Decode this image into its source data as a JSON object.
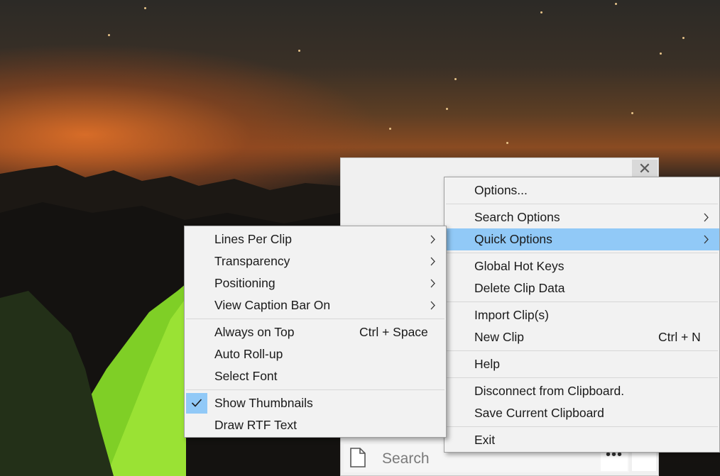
{
  "search": {
    "placeholder": "Search",
    "more_label": "•••"
  },
  "window": {
    "close_label": "✕"
  },
  "main_menu": {
    "items": [
      {
        "label": "Options..."
      },
      {
        "label": "Search Options"
      },
      {
        "label": "Quick Options"
      },
      {
        "label": "Global Hot Keys"
      },
      {
        "label": "Delete Clip Data"
      },
      {
        "label": "Import Clip(s)"
      },
      {
        "label": "New Clip",
        "shortcut": "Ctrl + N"
      },
      {
        "label": "Help"
      },
      {
        "label": "Disconnect from Clipboard."
      },
      {
        "label": "Save Current Clipboard"
      },
      {
        "label": "Exit"
      }
    ]
  },
  "quick_menu": {
    "items": [
      {
        "label": "Lines Per Clip"
      },
      {
        "label": "Transparency"
      },
      {
        "label": "Positioning"
      },
      {
        "label": "View Caption Bar On"
      },
      {
        "label": "Always on Top",
        "shortcut": "Ctrl + Space"
      },
      {
        "label": "Auto Roll-up"
      },
      {
        "label": "Select Font"
      },
      {
        "label": "Show Thumbnails",
        "checked": true
      },
      {
        "label": "Draw RTF Text"
      }
    ]
  },
  "colors": {
    "highlight": "#91c9f7",
    "menu_bg": "#f2f2f2"
  }
}
